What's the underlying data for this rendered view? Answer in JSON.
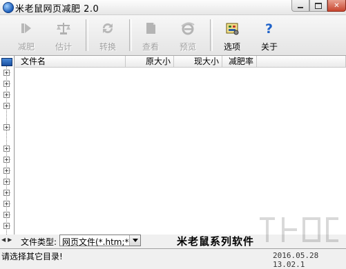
{
  "window": {
    "title": "米老鼠网页减肥 2.0"
  },
  "toolbar": {
    "buttons": [
      {
        "label": "减肥",
        "icon": "play-icon",
        "enabled": false
      },
      {
        "label": "估计",
        "icon": "scale-icon",
        "enabled": false
      },
      {
        "label": "转换",
        "icon": "refresh-icon",
        "enabled": false
      },
      {
        "label": "查看",
        "icon": "view-icon",
        "enabled": false
      },
      {
        "label": "预览",
        "icon": "ie-browser-icon",
        "enabled": false
      },
      {
        "label": "选项",
        "icon": "options-icon",
        "enabled": true
      },
      {
        "label": "关于",
        "icon": "question-icon",
        "enabled": true
      }
    ]
  },
  "file_list": {
    "columns": [
      "文件名",
      "原大小",
      "现大小",
      "减肥率"
    ],
    "rows": []
  },
  "bottom": {
    "file_type_label": "文件类型:",
    "file_type_value": "网页文件(*.htm;*",
    "brand": "米老鼠系列软件"
  },
  "status": {
    "message": "请选择其它目录!",
    "datetime": "2016.05.28 13.02.1"
  },
  "colors": {
    "accent": "#1a5bb8",
    "disabled_text": "#a0a0a0"
  }
}
